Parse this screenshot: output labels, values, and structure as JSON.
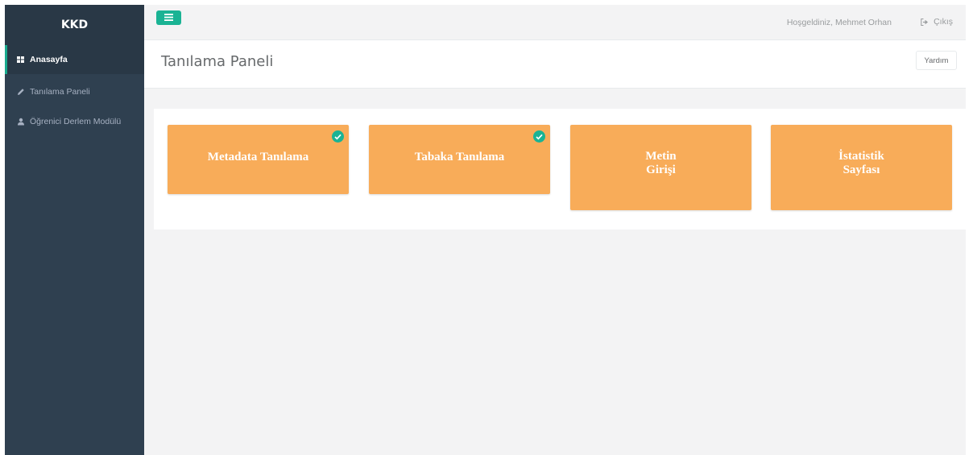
{
  "sidebar": {
    "brand": "KKD",
    "items": [
      {
        "label": "Anasayfa",
        "icon": "th-large-icon",
        "active": true
      },
      {
        "label": "Tanılama Paneli",
        "icon": "pencil-icon",
        "active": false
      },
      {
        "label": "Öğrenici Derlem Modülü",
        "icon": "user-icon",
        "active": false
      }
    ]
  },
  "topbar": {
    "welcome": "Hoşgeldiniz, Mehmet Orhan",
    "logout_label": "Çıkış",
    "toggle_icon": "bars-icon"
  },
  "page": {
    "title": "Tanılama Paneli",
    "help_label": "Yardım"
  },
  "cards": [
    {
      "lines": [
        "Metadata Tanılama"
      ],
      "completed": true
    },
    {
      "lines": [
        "Tabaka Tanılama"
      ],
      "completed": true
    },
    {
      "lines": [
        "Metin",
        "Girişi"
      ],
      "completed": false
    },
    {
      "lines": [
        "İstatistik",
        "Sayfası"
      ],
      "completed": false
    }
  ],
  "colors": {
    "sidebar_bg": "#2f4050",
    "accent_green": "#1ab394",
    "card_orange": "#f8ac59",
    "content_bg": "#f3f3f4"
  }
}
